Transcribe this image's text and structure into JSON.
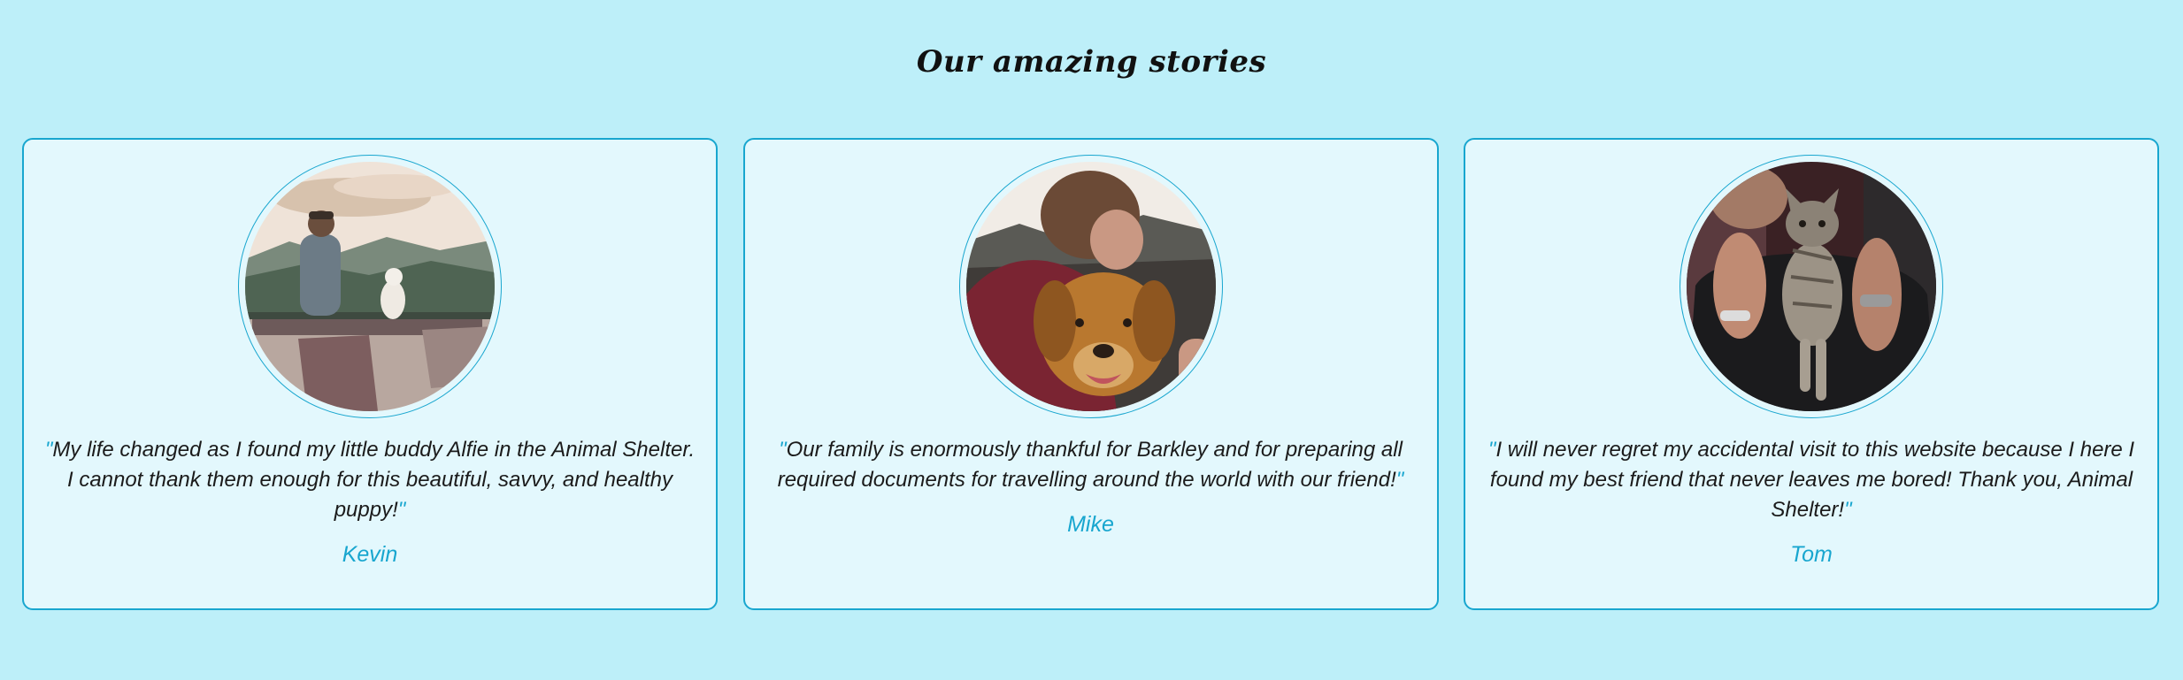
{
  "page": {
    "title": "Our amazing stories"
  },
  "colors": {
    "background": "#bdeff9",
    "card_background": "#e3f8fd",
    "accent": "#18a6cf",
    "text": "#1b1b1b"
  },
  "stories": [
    {
      "photo": "man-with-dog-on-mountain-photo",
      "quote": "My life changed as I found my little buddy Alfie in the Animal Shelter. I cannot thank them enough for this beautiful, savvy, and healthy puppy!",
      "name": "Kevin"
    },
    {
      "photo": "man-hugging-golden-retriever-photo",
      "quote": "Our family is enormously thankful for Barkley and for preparing all required documents for travelling around the world with our friend!",
      "name": "Mike"
    },
    {
      "photo": "man-holding-tabby-kitten-photo",
      "quote": "I will never regret my accidental visit to this website because I here I found my best friend that never leaves me bored! Thank you, Animal Shelter!",
      "name": "Tom"
    }
  ],
  "quote_mark": "\""
}
